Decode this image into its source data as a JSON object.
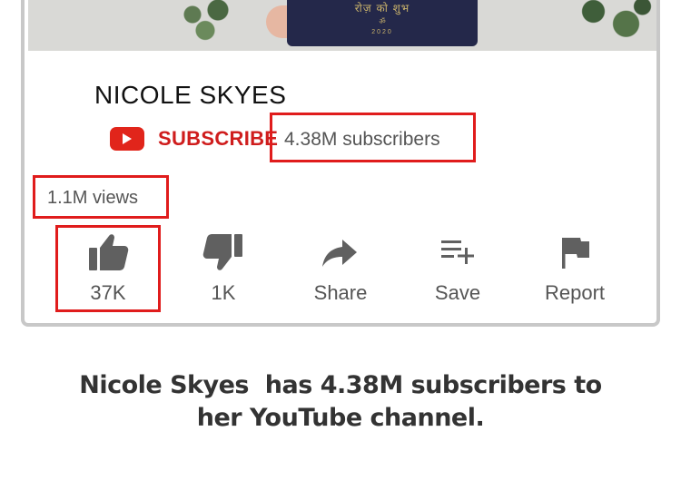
{
  "video": {
    "book_title": "रोज़ को शुभ",
    "book_sub": "ॐ",
    "book_year": "2020"
  },
  "channel": {
    "name": "NICOLE SKYES",
    "subscribe_label": "SUBSCRIBE",
    "subscriber_count": "4.38M subscribers"
  },
  "stats": {
    "views": "1.1M views"
  },
  "actions": [
    {
      "label": "37K",
      "icon": "thumbs-up-icon"
    },
    {
      "label": "1K",
      "icon": "thumbs-down-icon"
    },
    {
      "label": "Share",
      "icon": "share-icon"
    },
    {
      "label": "Save",
      "icon": "playlist-add-icon"
    },
    {
      "label": "Report",
      "icon": "flag-icon"
    }
  ],
  "caption": {
    "line1": "Nicole Skyes  has 4.38M subscribers to",
    "line2": "her YouTube channel."
  },
  "colors": {
    "highlight": "#e01c1c",
    "youtube_red": "#e1251b",
    "subscribe_text": "#cf1d1d"
  }
}
